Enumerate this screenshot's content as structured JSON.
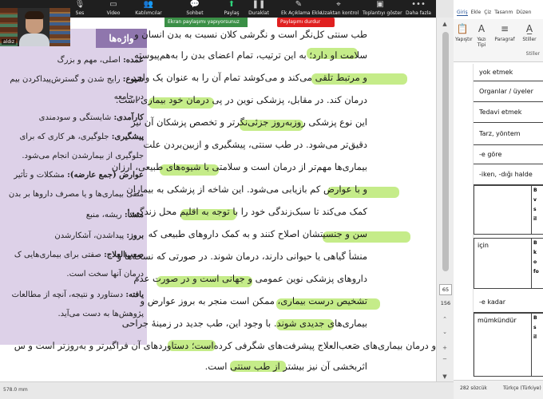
{
  "zoom_toolbar": {
    "items": [
      {
        "icon": "microphone-icon",
        "label": "Ses"
      },
      {
        "icon": "video-icon",
        "label": "Video"
      },
      {
        "icon": "participants-icon",
        "label": "Katılımcılar"
      },
      {
        "icon": "chat-icon",
        "label": "Sohbet"
      },
      {
        "icon": "share-icon",
        "label": "Paylaş"
      },
      {
        "icon": "pause-icon",
        "label": "Duraklat"
      },
      {
        "icon": "annotate-icon",
        "label": "Ek Açıklama Ekle"
      },
      {
        "icon": "remote-control-icon",
        "label": "Uzaktan kontrol"
      },
      {
        "icon": "captions-icon",
        "label": "Toplantıyı göster"
      },
      {
        "icon": "more-icon",
        "label": "Daha fazla"
      }
    ],
    "share_notice": "Ekran paylaşımı yapıyorsunuz",
    "stop_share": "Paylaşımı durdur",
    "colors": {
      "bar": "#1f1f1f",
      "share_green": "#3a8f46",
      "stop_red": "#e02020"
    }
  },
  "video_thumb": {
    "name": "aldız"
  },
  "glossary": {
    "heading": "واژه‌ها",
    "lines": [
      {
        "term": "عمده:",
        "text": "اصلی، مهم و بزرگ"
      },
      {
        "term": "شیوع:",
        "text": "رایج شدن و گسترش‌پیداکردن بیم"
      },
      {
        "term": "",
        "text": "در جامعه"
      },
      {
        "term": "کارآمدی:",
        "text": "شایستگی و سودمندی"
      },
      {
        "term": "پیشگیری:",
        "text": "جلوگیری، هر کاری که برای"
      },
      {
        "term": "",
        "text": "جلوگیری از بیمارشدن انجام می‌شود."
      },
      {
        "term": "عوارض (جمع عارضه):",
        "text": "مشکلات و تأثیر"
      },
      {
        "term": "",
        "text": "منفی بیماری‌ها و یا مصرف داروها بر بدن"
      },
      {
        "term": "منشأ:",
        "text": "ریشه، منبع"
      },
      {
        "term": "بروز:",
        "text": "پیداشدن، آشکارشدن"
      },
      {
        "term": "صعب‌العلاج:",
        "text": "صفتی برای بیماری‌هایی ک"
      },
      {
        "term": "",
        "text": "درمان آنها سخت است."
      },
      {
        "term": "یافته:",
        "text": "دستاورد و نتیجه، آنچه از مطالعات"
      },
      {
        "term": "",
        "text": "پژوهش‌ها به دست می‌آید."
      }
    ]
  },
  "paragraph_lines": [
    "طب سنتی کل‌نگر است و نگرشی کلان نسبت به بدن انسان و",
    "سلامت او دارد؛ به این ترتیب، تمام اعضای بدن را به‌هم‌پیوسته",
    "و مرتبط تلقی می‌کند و می‌کوشد تمام آن را به عنوان یک واحد",
    "درمان کند. در مقابل، پزشکی نوین در پی درمان خود بیماری است.",
    "این نوع پزشکی روزبه‌روز جزئی‌نگرتر و تخصص پزشکان آن نیز",
    "دقیق‌تر می‌شود. در طب سنتی، پیشگیری و ازبین‌بردن علت",
    "بیماری‌ها مهم‌تر از درمان است و سلامتی با شیوه‌های طبیعی، ارزان",
    "و با عوارض کم بازیابی می‌شود. این شاخه از پزشکی به بیماران",
    "کمک می‌کند تا سبک‌زندگی خود را با توجه به اقلیم محل زندگی،",
    "سن و جنسیتشان اصلاح کنند و به کمک داروهای طبیعی که",
    "منشأ گیاهی یا حیوانی دارند، درمان شوند. در صورتی که نسخه‌ها و",
    "داروهای پزشکی نوین عمومی و جهانی است و در صورت عدم",
    "تشخیص درست بیماری، ممکن است منجر به بروز عوارض و",
    "بیماری‌های جدیدی شوند. با وجود این، طب جدید در زمینهٔ جراحی",
    "و درمان بیماری‌های صَعب‌العلاج پیشرفت‌های شگرفی کرده‌است؛ دستاوردهای آن فراگیرتر و به‌روزتر است و س",
    "اثربخشی آن نیز بیشتر از طب سنتی است."
  ],
  "pdf_viewer": {
    "page_current": "65",
    "page_total": "156",
    "status": "578.0 mm"
  },
  "word": {
    "tabs": [
      "Giriş",
      "Ekle",
      "Çiz",
      "Tasarım",
      "Düzen"
    ],
    "ribbon": {
      "paste_label": "Yapıştır",
      "font_label": "Yazı Tipi",
      "paragraph_label": "Paragraf",
      "styles_label": "Stiller",
      "styles_group": "Stiller"
    },
    "rows": [
      "yok etmek",
      "Organlar / üyeler",
      "Tedavi etmek",
      "Tarz, yöntem",
      "-e göre",
      "-iken, -dığı halde"
    ],
    "table1": {
      "label": "",
      "right": [
        "B",
        "v",
        "s",
        "il"
      ]
    },
    "table2": {
      "label": "için",
      "right": [
        "B",
        "k",
        "o",
        "fo"
      ]
    },
    "row_kadar": "-e kadar",
    "table3": {
      "label": "mümkündür",
      "right": [
        "B",
        "s",
        "il"
      ]
    },
    "status": {
      "words": "282 sözcük",
      "language": "Türkçe (Türkiye)"
    }
  }
}
